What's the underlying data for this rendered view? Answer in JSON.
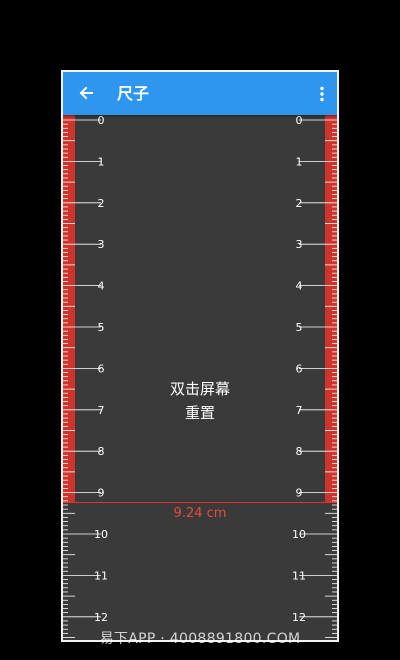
{
  "appbar": {
    "title": "尺子",
    "back_icon": "arrow-left-icon",
    "menu_icon": "more-vertical-icon",
    "color": "#2f96ef"
  },
  "ruler": {
    "left_labels": [
      "0",
      "1",
      "2",
      "3",
      "4",
      "5",
      "6",
      "7",
      "8",
      "9",
      "10",
      "11",
      "12"
    ],
    "right_labels": [
      "0",
      "1",
      "2",
      "3",
      "4",
      "5",
      "6",
      "7",
      "8",
      "9",
      "10",
      "11",
      "12"
    ],
    "measured_cm": 9.24,
    "highlight_color": "#e0342b",
    "tick_color": "#ffffff",
    "background_color": "#3a3a3a"
  },
  "hint": {
    "line1": "双击屏幕",
    "line2": "重置"
  },
  "measurement": {
    "label": "9.24 cm"
  },
  "watermark": "易下APP · 4008891800.COM"
}
